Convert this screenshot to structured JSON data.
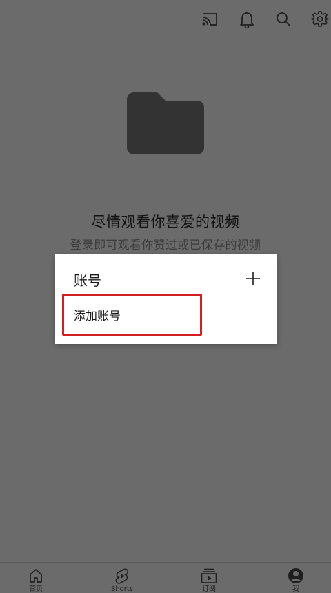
{
  "top_bar": {
    "icons": [
      "cast-icon",
      "notifications-icon",
      "search-icon",
      "settings-icon"
    ]
  },
  "empty_state": {
    "title": "尽情观看你喜爱的视频",
    "subtitle": "登录即可观看你赞过或已保存的视频"
  },
  "dialog": {
    "title": "账号",
    "add_icon": "plus-icon",
    "option_label": "添加账号"
  },
  "bottom_nav": {
    "items": [
      {
        "label": "首页",
        "icon": "home-icon"
      },
      {
        "label": "Shorts",
        "icon": "shorts-icon"
      },
      {
        "label": "订阅",
        "icon": "subscriptions-icon"
      },
      {
        "label": "我",
        "icon": "account-icon"
      }
    ]
  },
  "colors": {
    "scrim": "#6b6b6b",
    "dialog_bg": "#ffffff",
    "highlight": "#d41f1f",
    "icon": "#1f1f1f",
    "folder": "#333333"
  }
}
